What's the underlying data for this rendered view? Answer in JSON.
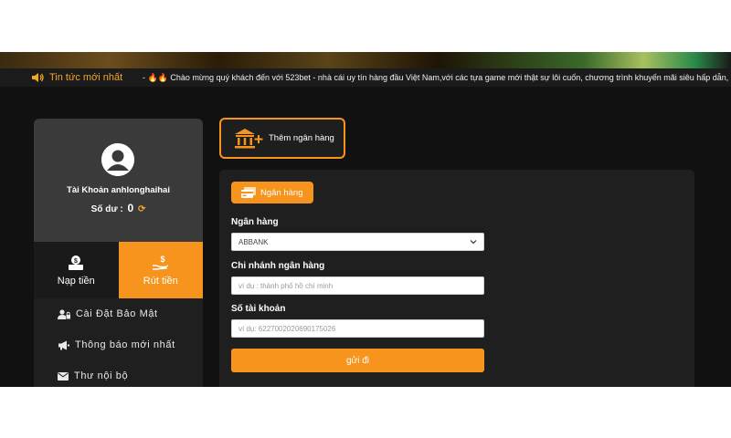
{
  "ticker": {
    "label": "Tin tức mới nhất",
    "message": "- 🔥🔥 Chào mừng quý khách đến với 523bet - nhà cái uy tín hàng đầu Việt Nam,với các tựa game mới thật sự lôi cuốn, chương trình khuyến mãi siêu hấp dẫn,"
  },
  "account": {
    "name": "Tài Khoản anhlonghaihai",
    "balance_label": "Số dư :",
    "balance_value": "0"
  },
  "actions": {
    "deposit": "Nạp tiền",
    "withdraw": "Rút tiền"
  },
  "menu": {
    "items": [
      {
        "label": "Cài Đặt Bảo Mật",
        "icon": "user-lock-icon"
      },
      {
        "label": "Thông báo mới nhất",
        "icon": "megaphone-icon"
      },
      {
        "label": "Thư nội bộ",
        "icon": "envelope-icon"
      }
    ]
  },
  "add_bank": {
    "label": "Thêm ngân hàng",
    "icon": "bank-plus-icon"
  },
  "form": {
    "tab_label": "Ngân hàng",
    "bank_label": "Ngân hàng",
    "bank_value": "ABBANK",
    "branch_label": "Chi nhánh ngân hàng",
    "branch_placeholder": "ví dụ : thành phố hồ chí minh",
    "account_label": "Số tài khoản",
    "account_placeholder": "ví dụ:  6227002020690175026",
    "submit_label": "gửi đi"
  },
  "colors": {
    "accent": "#f7941d",
    "background": "#111111",
    "panel": "#1f1f1f"
  }
}
